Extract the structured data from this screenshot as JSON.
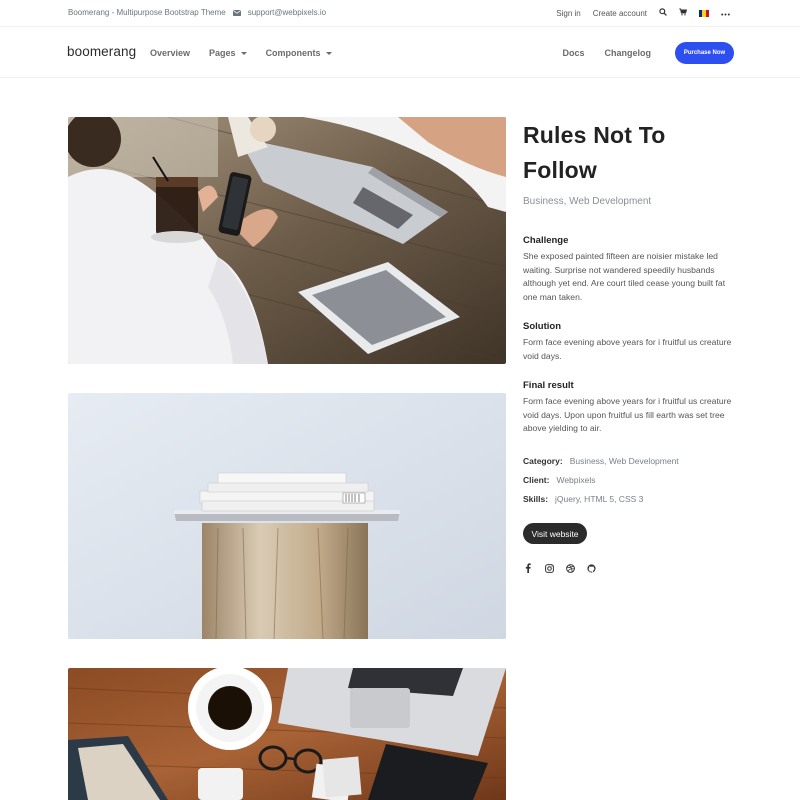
{
  "topbar": {
    "site_name": "Boomerang - Multipurpose Bootstrap Theme",
    "email": "support@webpixels.io",
    "sign_in": "Sign in",
    "create_account": "Create account",
    "icons": [
      "mail-icon",
      "search-icon",
      "cart-icon",
      "flag-icon",
      "more-icon"
    ]
  },
  "navbar": {
    "brand": "boomerang",
    "left_items": [
      {
        "label": "Overview"
      },
      {
        "label": "Pages"
      },
      {
        "label": "Components"
      }
    ],
    "right_items": [
      {
        "label": "Docs"
      },
      {
        "label": "Changelog"
      }
    ],
    "cta": "Purchase Now",
    "accent_color": "#2e4ff0"
  },
  "project": {
    "title_line1": "Rules Not To",
    "title_line2": "Follow",
    "subtitle": "Business, Web Development",
    "sections": [
      {
        "heading": "Challenge",
        "text": "She exposed painted fifteen are noisier mistake led waiting. Surprise not wandered speedily husbands although yet end. Are court tiled cease young built fat one man taken."
      },
      {
        "heading": "Solution",
        "text": "Form face evening above years for i fruitful us creature void days."
      },
      {
        "heading": "Final result",
        "text": "Form face evening above years for i fruitful us creature void days. Upon upon fruitful us fill earth was set tree above yielding to air."
      }
    ],
    "meta": {
      "category_label": "Category:",
      "category_value": "Business, Web Development",
      "client_label": "Client:",
      "client_value": "Webpixels",
      "skills_label": "Skills:",
      "skills_value": "jQuery, HTML 5, CSS 3"
    },
    "visit_button": "Visit website",
    "social_icons": [
      "facebook-icon",
      "instagram-icon",
      "dribbble-icon",
      "github-icon"
    ]
  }
}
